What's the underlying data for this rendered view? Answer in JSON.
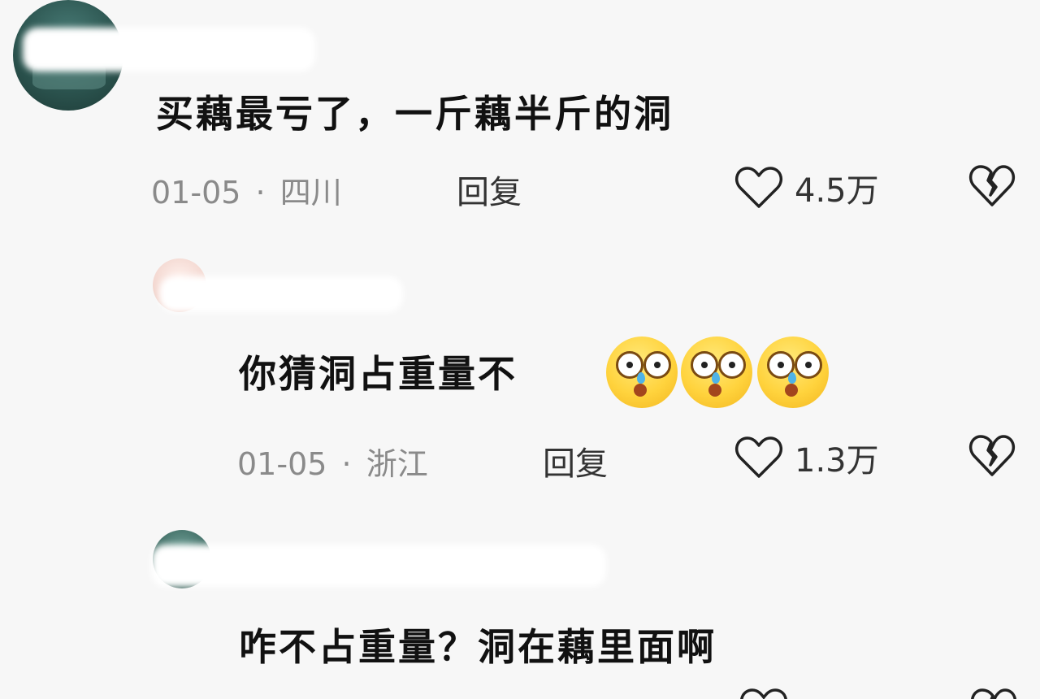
{
  "comments": [
    {
      "text": "买藕最亏了，一斤藕半斤的洞",
      "date": "01-05",
      "separator": "·",
      "location": "四川",
      "reply_label": "回复",
      "likes": "4.5万"
    },
    {
      "text": "你猜洞占重量不",
      "date": "01-05",
      "separator": "·",
      "location": "浙江",
      "reply_label": "回复",
      "likes": "1.3万"
    },
    {
      "text": "咋不占重量？洞在藕里面啊"
    }
  ],
  "icons": {
    "like": "heart-outline-icon",
    "dislike": "broken-heart-icon",
    "emoji": "astonished-crying-emoji"
  }
}
